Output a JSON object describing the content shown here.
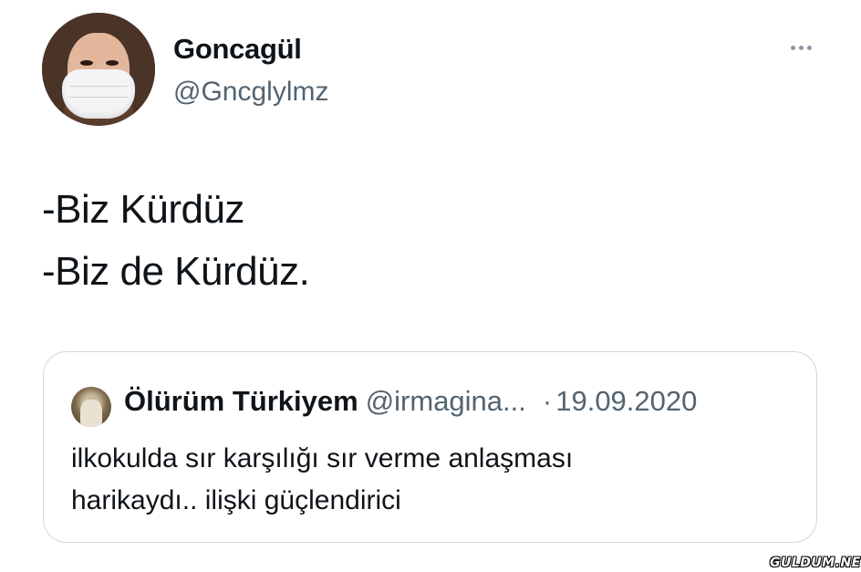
{
  "author": {
    "display_name": "Goncagül",
    "handle": "@Gncglylmz",
    "avatar_icon": "profile-photo-masked-woman"
  },
  "more_icon": "more-horizontal-icon",
  "tweet": {
    "lines": [
      "-Biz Kürdüz",
      "-Biz de Kürdüz."
    ]
  },
  "quoted_tweet": {
    "display_name": "Ölürüm Türkiyem",
    "handle": "@irmagina...",
    "separator": "·",
    "date": "19.09.2020",
    "lines": [
      "ilkokulda sır karşılığı sır verme anlaşması",
      "harikaydı.. ilişki güçlendirici"
    ]
  },
  "watermark": "GULDUM.NET",
  "colors": {
    "text": "#0f1419",
    "secondary": "#536471",
    "border": "#cfd9de"
  }
}
